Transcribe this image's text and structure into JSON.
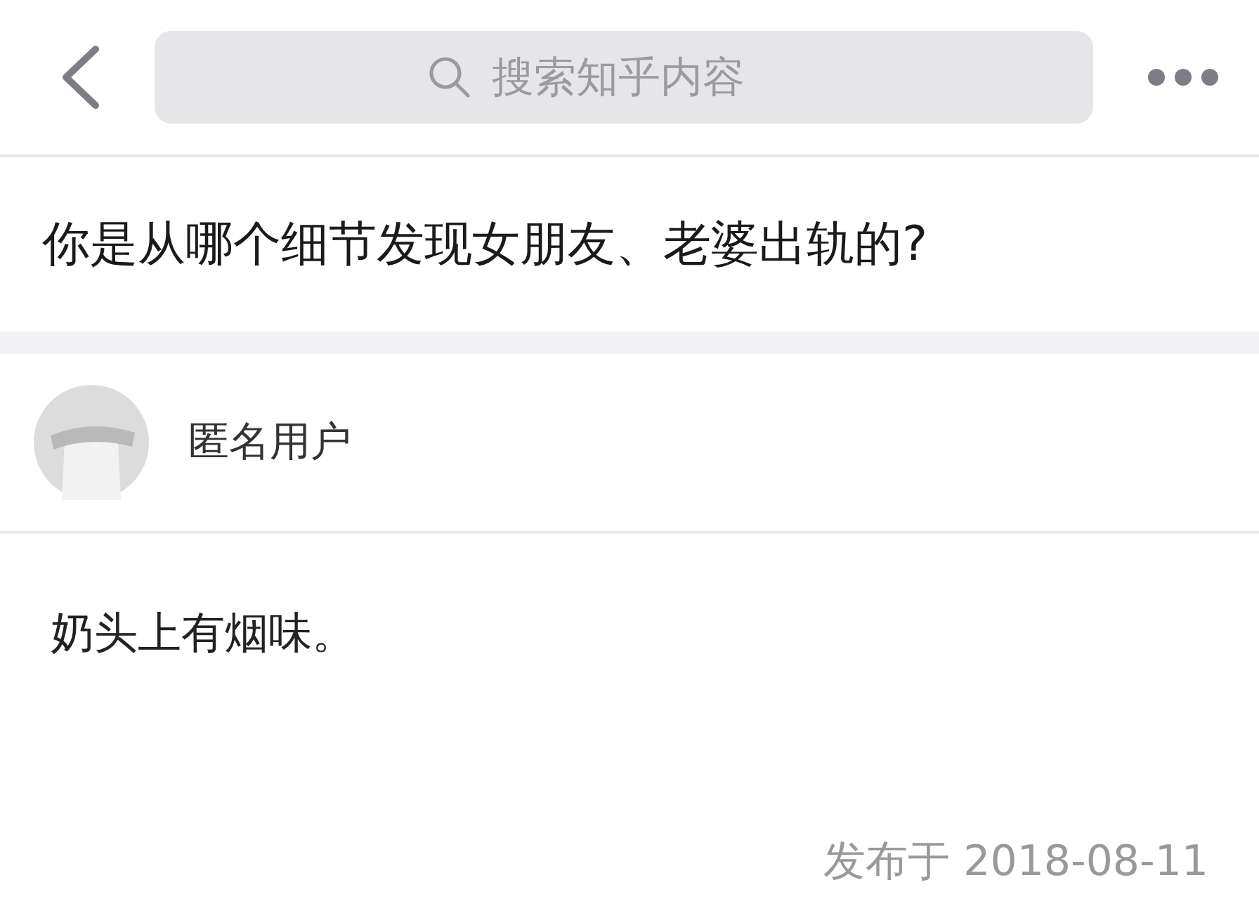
{
  "nav": {
    "search": {
      "placeholder": "搜索知乎内容"
    }
  },
  "question": {
    "title": "你是从哪个细节发现女朋友、老婆出轨的?"
  },
  "answer": {
    "author": "匿名用户",
    "content": "奶头上有烟味。",
    "date": "发布于 2018-08-11"
  }
}
